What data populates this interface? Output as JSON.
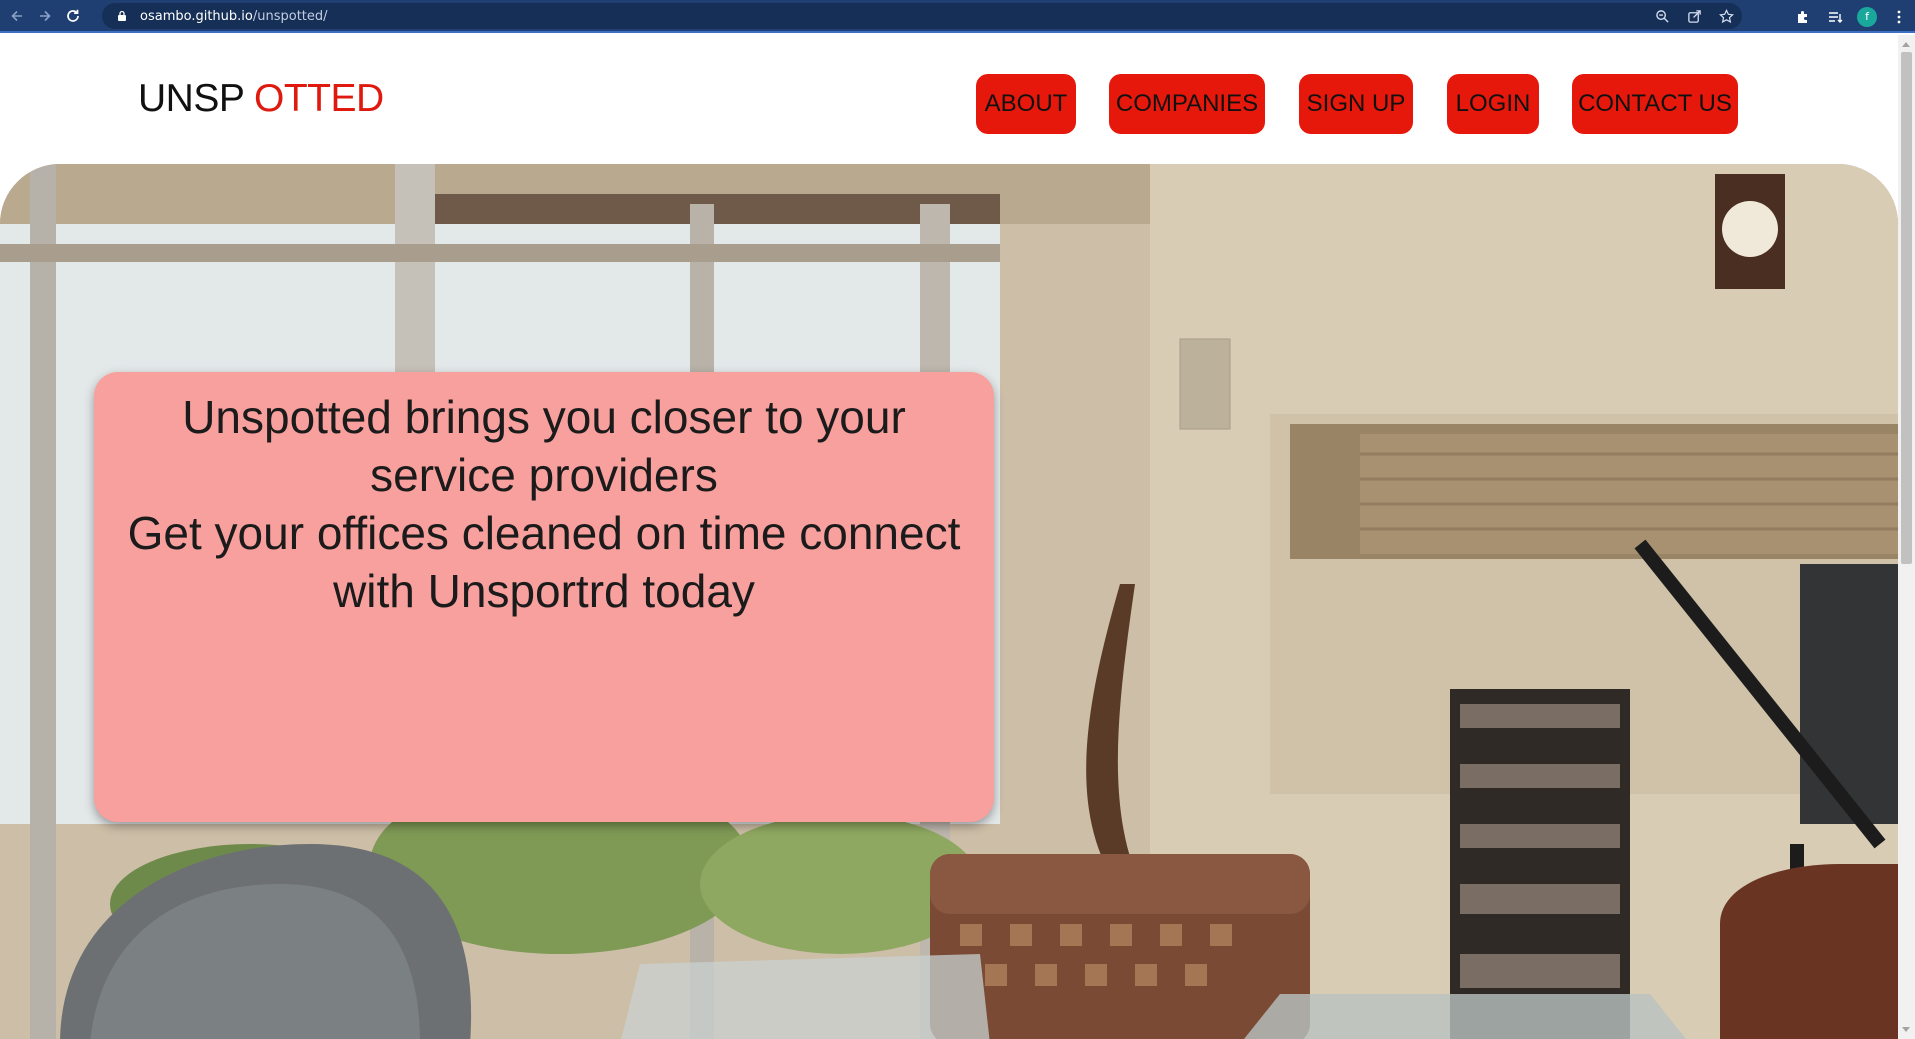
{
  "browser": {
    "url_host": "osambo.github.io",
    "url_path": "/unspotted/",
    "profile_initial": "f",
    "icons": {
      "back": "back-arrow-icon",
      "forward": "forward-arrow-icon",
      "reload": "reload-icon",
      "lock": "lock-icon",
      "zoom": "zoom-icon",
      "share": "share-icon",
      "bookmark": "star-icon",
      "extensions": "puzzle-icon",
      "reading_list": "reading-list-icon",
      "menu": "kebab-menu-icon"
    }
  },
  "header": {
    "logo_part1": "UNSP",
    "logo_part2": "OTTED",
    "nav": [
      {
        "label": "ABOUT"
      },
      {
        "label": "COMPANIES"
      },
      {
        "label": "SIGN UP"
      },
      {
        "label": "LOGIN"
      },
      {
        "label": "CONTACT US"
      }
    ]
  },
  "hero": {
    "lines": [
      "Unspotted brings you closer to your",
      "service providers",
      "Get your offices cleaned on time connect",
      "with Unsportrd today"
    ]
  },
  "colors": {
    "brand_red": "#e6170b",
    "logo_red": "#e0190e",
    "card_pink": "#f8a09d",
    "chrome_blue": "#1f3f73"
  }
}
